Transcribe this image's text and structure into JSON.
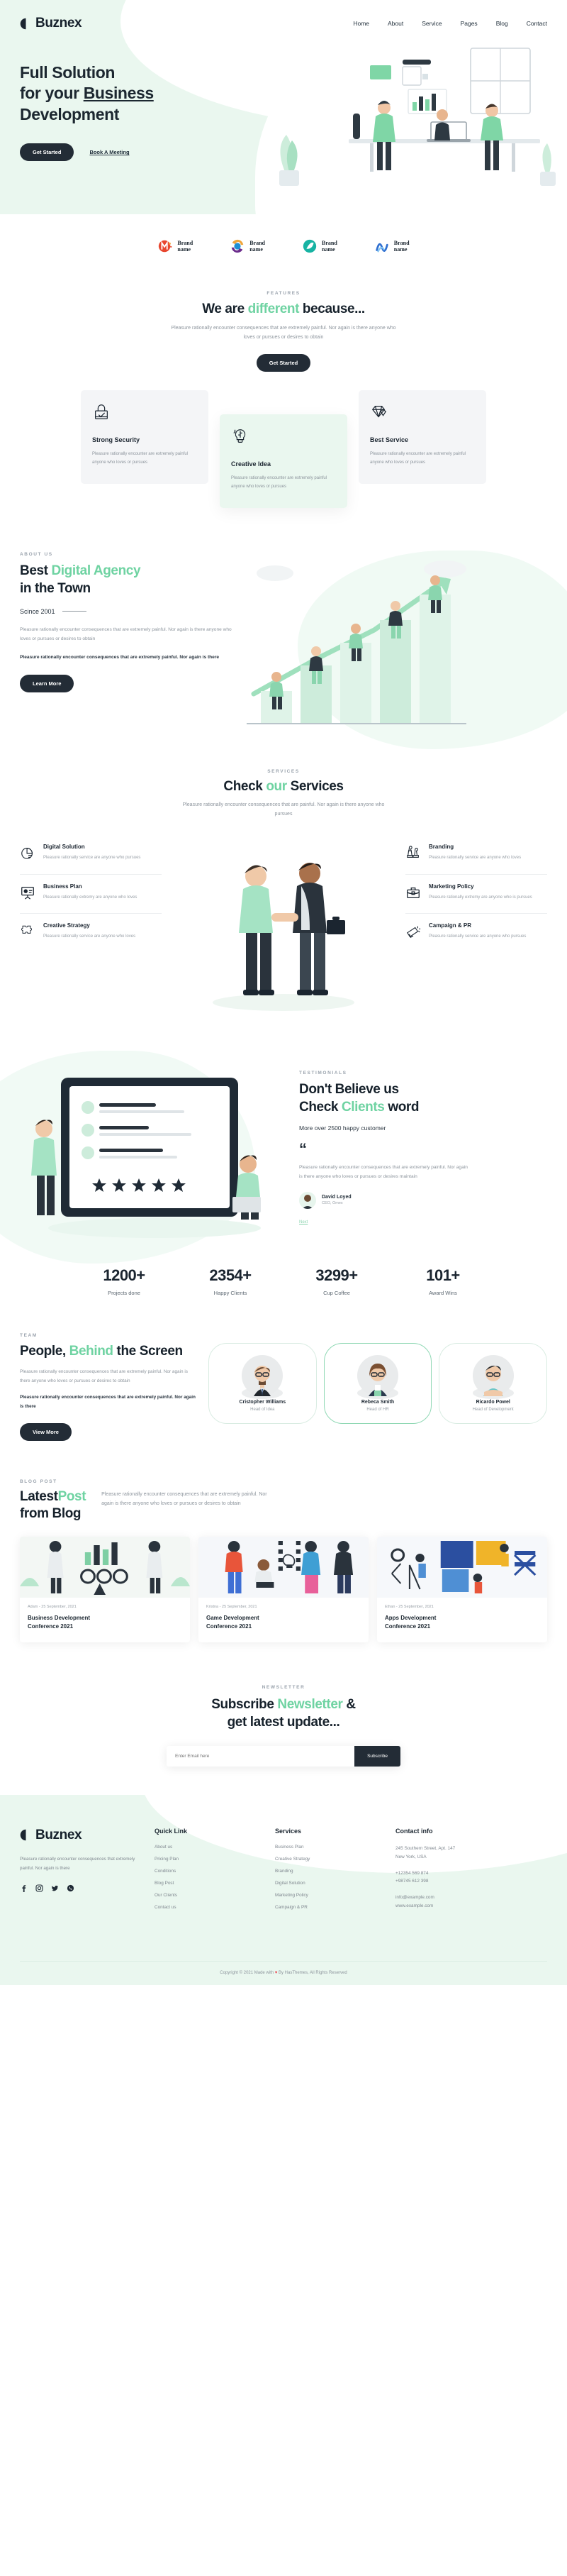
{
  "brandColors": {
    "accent": "#6fd3a2",
    "dark": "#232c36",
    "heroBg": "#eaf7ef",
    "mutedText": "#8d959d"
  },
  "header": {
    "logo_text": "Buznex",
    "logo_icon": "buznex-mark-icon",
    "nav": [
      {
        "label": "Home"
      },
      {
        "label": "About"
      },
      {
        "label": "Service"
      },
      {
        "label": "Pages"
      },
      {
        "label": "Blog"
      },
      {
        "label": "Contact"
      }
    ]
  },
  "hero": {
    "title_line1": "Full Solution",
    "title_line2_pre": "for your ",
    "title_line2_underline": "Business",
    "title_line3": "Development",
    "primary_btn": "Get Started",
    "secondary_link": "Book A Meeting"
  },
  "brands": [
    {
      "name_line1": "Brand",
      "name_line2": "name",
      "icon": "brand-logo-m-icon"
    },
    {
      "name_line1": "Brand",
      "name_line2": "name",
      "icon": "brand-logo-swirl-icon"
    },
    {
      "name_line1": "Brand",
      "name_line2": "name",
      "icon": "brand-logo-leaf-icon"
    },
    {
      "name_line1": "Brand",
      "name_line2": "name",
      "icon": "brand-logo-wave-icon"
    }
  ],
  "features": {
    "eyebrow": "FEATURES",
    "title_pre": "We are ",
    "title_accent": "different",
    "title_post": " because...",
    "subtitle": "Pleasure rationally encounter consequences that are extremely painful. Nor again is there anyone who loves or pursues or desires to obtain",
    "button": "Get Started",
    "cards": [
      {
        "icon": "lock-check-icon",
        "title": "Strong Security",
        "text": "Pleasure rationally encounter are extremely painful anyone who loves or pursues"
      },
      {
        "icon": "brain-bulb-icon",
        "title": "Creative Idea",
        "text": "Pleasure rationally encounter are extremely painful anyone who loves or pursues"
      },
      {
        "icon": "diamond-icon",
        "title": "Best Service",
        "text": "Pleasure rationally encounter are extremely painful anyone who loves or pursues"
      }
    ]
  },
  "about": {
    "eyebrow": "ABOUT US",
    "title_pre": "Best ",
    "title_accent": "Digital Agency",
    "title_post": "in the Town",
    "since": "Scince 2001",
    "paragraph_muted": "Pleasure rationally encounter consequences that are extremely painful. Nor again is there anyone who loves or pursues or desires to obtain",
    "paragraph_bold": "Pleasure rationally encounter consequences that are extremely painful. Nor again is there",
    "button": "Learn More"
  },
  "services": {
    "eyebrow": "SERVICES",
    "title_pre": "Check ",
    "title_accent": "our",
    "title_post": " Services",
    "subtitle": "Pleasure rationally encounter consequences that are painful. Nor again is there anyone who pursues",
    "left": [
      {
        "icon": "pie-chart-icon",
        "title": "Digital Solution",
        "text": "Pleasure rationally service are anyone who pursues"
      },
      {
        "icon": "presentation-board-icon",
        "title": "Business Plan",
        "text": "Pleasure rationally extremy are anyone who loves"
      },
      {
        "icon": "puzzle-icon",
        "title": "Creative Strategy",
        "text": "Pleasure rationally service are anyone who loves"
      }
    ],
    "right": [
      {
        "icon": "chess-pieces-icon",
        "title": "Branding",
        "text": "Pleasure rationally service are anyone who loves"
      },
      {
        "icon": "briefcase-icon",
        "title": "Marketing Policy",
        "text": "Pleasure rationally extremy are anyone who is pursues"
      },
      {
        "icon": "megaphone-icon",
        "title": "Campaign & PR",
        "text": "Pleasure rationally service are anyone who pursues"
      }
    ]
  },
  "testimonials": {
    "eyebrow": "TESTIMONIALS",
    "title_line1": "Don't Believe us",
    "title_line2_pre": "Check ",
    "title_line2_accent": "Clients",
    "title_line2_post": " word",
    "subtitle": "More over 2500 happy customer",
    "quote_icon": "quote-mark-icon",
    "quote_text": "Pleasure rationally encounter consequences that are extremely painful. Nor again is there anyone who loves or pursues or desires maintain",
    "author_name": "David Loyed",
    "author_role": "CEO, Omex",
    "next_label": "Next"
  },
  "stats": [
    {
      "value": "1200+",
      "label": "Projects done"
    },
    {
      "value": "2354+",
      "label": "Happy Clients"
    },
    {
      "value": "3299+",
      "label": "Cup Coffee"
    },
    {
      "value": "101+",
      "label": "Award Wins"
    }
  ],
  "team": {
    "eyebrow": "TEAM",
    "title_pre": "People, ",
    "title_accent": "Behind",
    "title_post": " the Screen",
    "paragraph_muted": "Pleasure rationally encounter consequences that are extremely painful. Nor again is there anyone who loves or pursues or desires to obtain",
    "paragraph_bold": "Pleasure rationally encounter consequences that are extremely painful. Nor again is there",
    "button": "View More",
    "members": [
      {
        "name": "Cristopher Williams",
        "role": "Head of Idea",
        "avatar": "avatar-man-glasses-suit"
      },
      {
        "name": "Rebeca Smith",
        "role": "Head of HR",
        "avatar": "avatar-woman-glasses-blazer"
      },
      {
        "name": "Ricardo Powel",
        "role": "Head of Development",
        "avatar": "avatar-man-teal-shirt"
      }
    ]
  },
  "blog": {
    "eyebrow": "BLOG POST",
    "title_pre": "Latest",
    "title_accent": "Post",
    "title_post": "from Blog",
    "subtitle": "Pleasure rationally encounter consequences that are extremely painful. Nor again is there anyone who loves or pursues or desires to obtain",
    "posts": [
      {
        "meta": "Adam - 25 September, 2021",
        "title_line1": "Business Development",
        "title_line2": "Conference 2021",
        "thumb": "thumb-business-charts"
      },
      {
        "meta": "Kristna - 25 September, 2021",
        "title_line1": "Game Development",
        "title_line2": "Conference 2021",
        "thumb": "thumb-team-ideation"
      },
      {
        "meta": "Ethan - 25 September, 2021",
        "title_line1": "Apps Development",
        "title_line2": "Conference 2021",
        "thumb": "thumb-puzzle-build"
      }
    ]
  },
  "newsletter": {
    "eyebrow": "NEWSLETTER",
    "title_pre": "Subscribe ",
    "title_accent": "Newsletter",
    "title_post": " &",
    "title_line2": "get latest update...",
    "input_placeholder": "Enter Email here",
    "input_value": "",
    "button": "Subscribe"
  },
  "footer": {
    "logo_text": "Buznex",
    "about": "Pleasure rationally encounter consequences that extremely painful. Nor again is there",
    "socials": [
      {
        "name": "facebook-icon",
        "glyph": "f"
      },
      {
        "name": "instagram-icon",
        "glyph": "▣"
      },
      {
        "name": "twitter-icon",
        "glyph": "✈"
      },
      {
        "name": "whatsapp-icon",
        "glyph": "●"
      }
    ],
    "quick_link": {
      "title": "Quick Link",
      "items": [
        "About us",
        "Pricing Plan",
        "Conditions",
        "Blog Post",
        "Our Clients",
        "Contact us"
      ]
    },
    "services": {
      "title": "Services",
      "items": [
        "Business Plan",
        "Creative Strategy",
        "Branding",
        "Digital Solution",
        "Marketing Policy",
        "Campaign & PR"
      ]
    },
    "contact": {
      "title": "Contact info",
      "address_line1": "245 Southern Street, Apt. 147",
      "address_line2": "New York, USA",
      "phone1": "+12354 569 874",
      "phone2": "+98745 612 398",
      "email": "info@example.com",
      "website": "www.example.com"
    },
    "copyright_pre": "Copyright © 2021 Made with ",
    "copyright_heart": "♥",
    "copyright_post": " By HasThemes, All Rights Reserved"
  }
}
